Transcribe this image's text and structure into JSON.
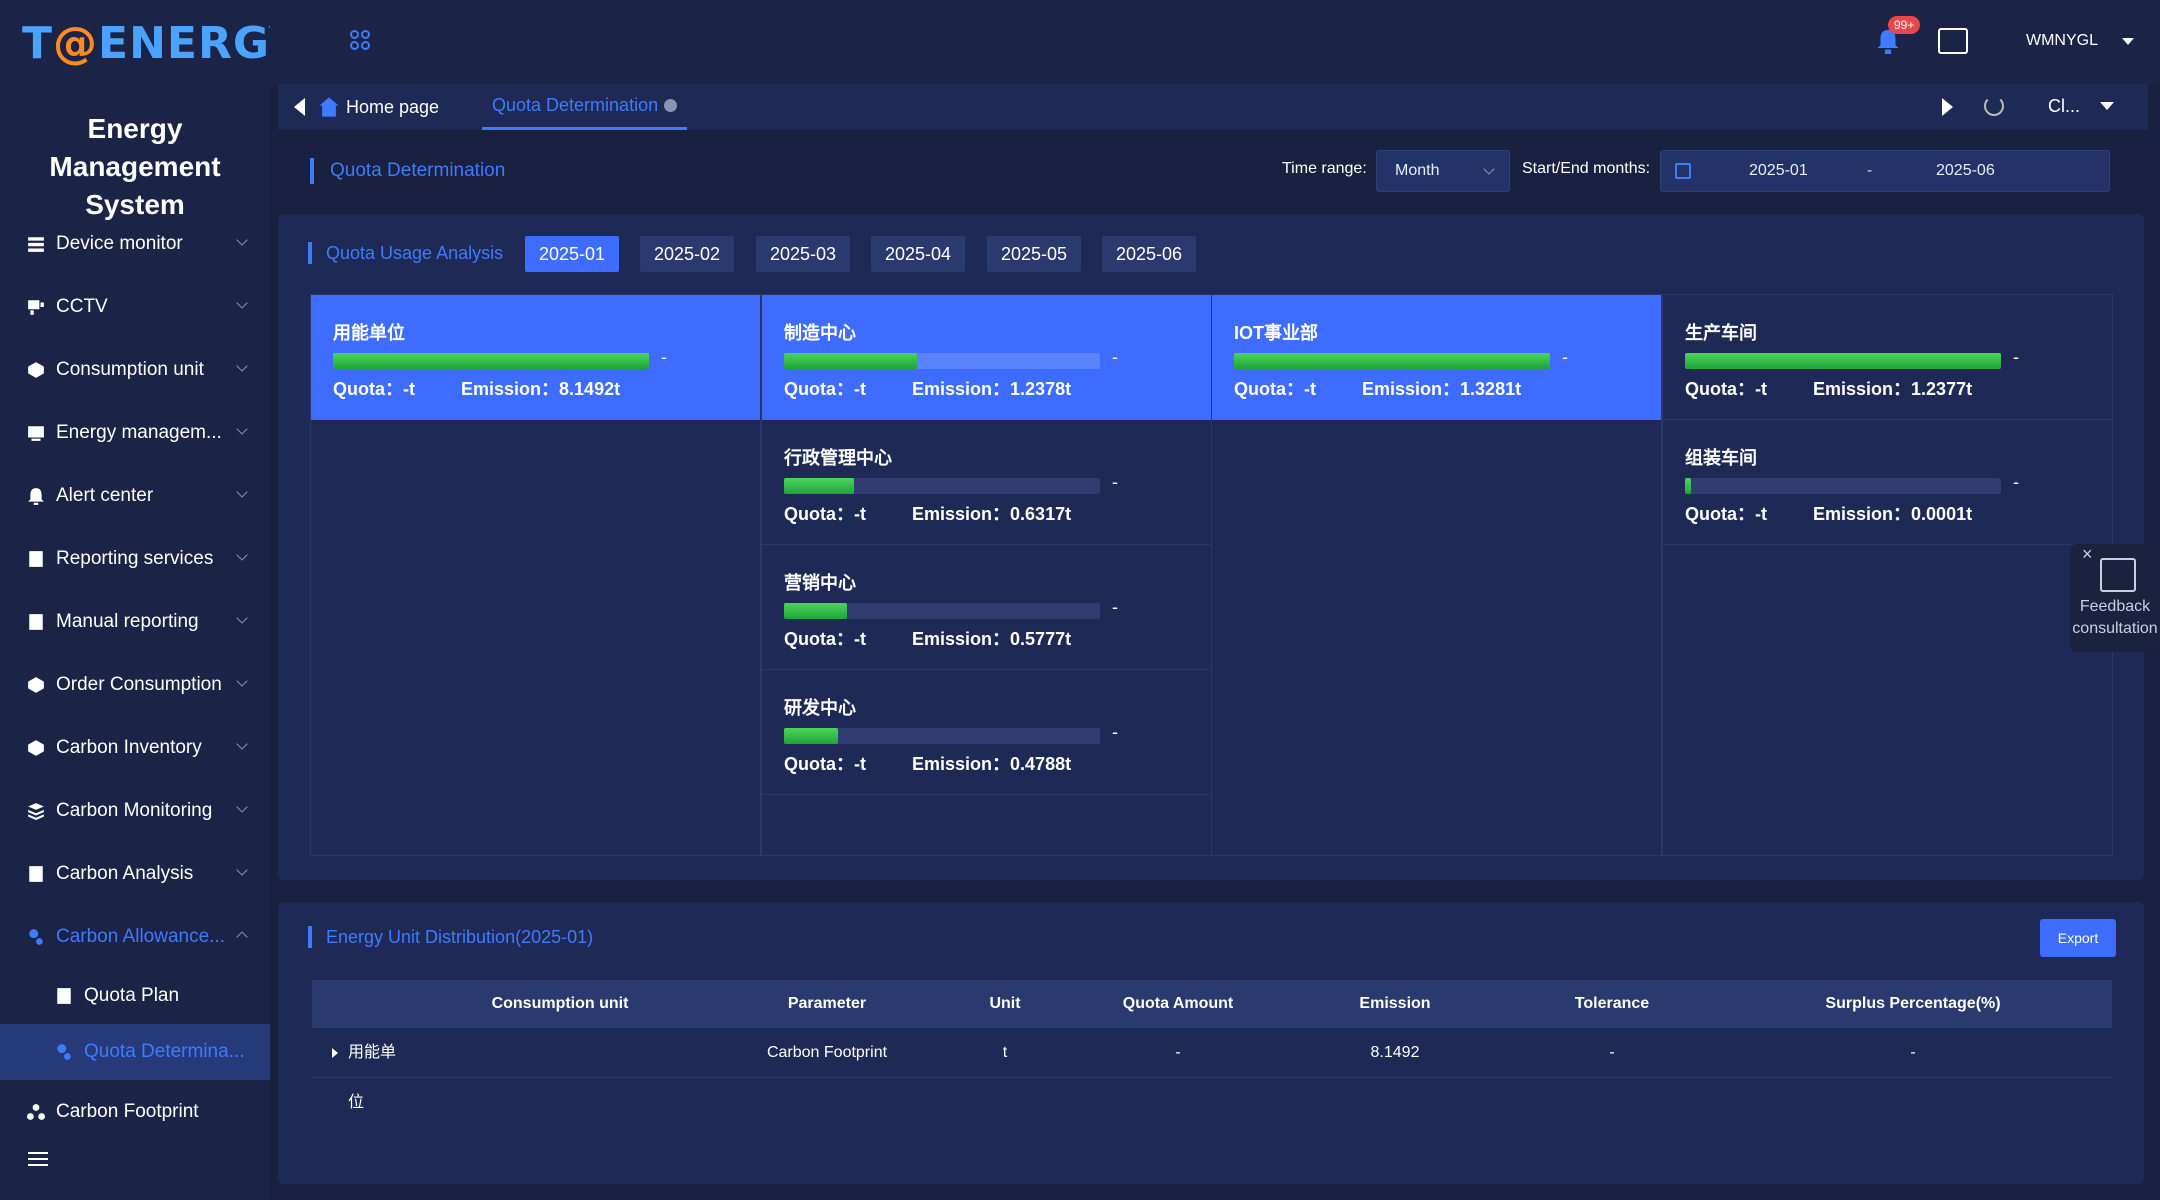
{
  "app": {
    "logo": {
      "brand_t": "T",
      "brand_at": "@",
      "brand_rest": "ENERGY"
    },
    "system_title_line1": "Energy Management",
    "system_title_line2": "System",
    "accent_color": "#3d6cff"
  },
  "sidebar": {
    "items": [
      {
        "label": "Device monitor",
        "icon": "device-icon"
      },
      {
        "label": "CCTV",
        "icon": "camera-icon"
      },
      {
        "label": "Consumption unit",
        "icon": "unit-icon"
      },
      {
        "label": "Energy managem...",
        "icon": "chart-icon"
      },
      {
        "label": "Alert center",
        "icon": "bell-icon"
      },
      {
        "label": "Reporting services",
        "icon": "report-icon"
      },
      {
        "label": "Manual reporting",
        "icon": "form-icon"
      },
      {
        "label": "Order Consumption",
        "icon": "box-icon"
      },
      {
        "label": "Carbon Inventory",
        "icon": "inventory-icon"
      },
      {
        "label": "Carbon Monitoring",
        "icon": "layers-icon"
      },
      {
        "label": "Carbon Analysis",
        "icon": "analysis-icon"
      },
      {
        "label": "Carbon Allowance...",
        "icon": "allowance-icon"
      },
      {
        "label": "Quota Plan",
        "icon": "plan-icon"
      },
      {
        "label": "Quota Determina...",
        "icon": "quota-icon"
      },
      {
        "label": "Carbon Footprint",
        "icon": "footprint-icon"
      }
    ]
  },
  "topbar": {
    "notification_badge": "99+",
    "username": "WMNYGL"
  },
  "tabs": {
    "home": "Home page",
    "quota": "Quota Determination",
    "close_label": "Cl..."
  },
  "page": {
    "title": "Quota Determination",
    "time_range_label": "Time range:",
    "time_range_value": "Month",
    "start_end_label": "Start/End months:",
    "start_month": "2025-01",
    "range_separator": "-",
    "end_month": "2025-06"
  },
  "usage": {
    "title": "Quota Usage Analysis",
    "months": [
      "2025-01",
      "2025-02",
      "2025-03",
      "2025-04",
      "2025-05",
      "2025-06"
    ],
    "active_month": "2025-01",
    "quota_prefix": "Quota：",
    "emission_prefix": "Emission：",
    "units": [
      {
        "name": "用能单位",
        "quota": "-t",
        "emission": "8.1492t",
        "progress": 1.0,
        "dash": "-",
        "highlight": true
      },
      {
        "name": "制造中心",
        "quota": "-t",
        "emission": "1.2378t",
        "progress": 0.42,
        "dash": "-",
        "highlight": true
      },
      {
        "name": "行政管理中心",
        "quota": "-t",
        "emission": "0.6317t",
        "progress": 0.22,
        "dash": "-",
        "highlight": false
      },
      {
        "name": "营销中心",
        "quota": "-t",
        "emission": "0.5777t",
        "progress": 0.2,
        "dash": "-",
        "highlight": false
      },
      {
        "name": "研发中心",
        "quota": "-t",
        "emission": "0.4788t",
        "progress": 0.17,
        "dash": "-",
        "highlight": false
      },
      {
        "name": "IOT事业部",
        "quota": "-t",
        "emission": "1.3281t",
        "progress": 1.0,
        "dash": "-",
        "highlight": true
      },
      {
        "name": "生产车间",
        "quota": "-t",
        "emission": "1.2377t",
        "progress": 1.0,
        "dash": "-",
        "highlight": false
      },
      {
        "name": "组装车间",
        "quota": "-t",
        "emission": "0.0001t",
        "progress": 0.02,
        "dash": "-",
        "highlight": false
      }
    ]
  },
  "feedback": {
    "line1": "Feedback",
    "line2": "consultation"
  },
  "distribution": {
    "title": "Energy Unit Distribution(2025-01)",
    "export_label": "Export",
    "columns": [
      "Consumption unit",
      "Parameter",
      "Unit",
      "Quota Amount",
      "Emission",
      "Tolerance",
      "Surplus Percentage(%)"
    ],
    "rows": [
      [
        "用能单位",
        "Carbon Footprint",
        "t",
        "-",
        "8.1492",
        "-",
        "-"
      ]
    ]
  }
}
